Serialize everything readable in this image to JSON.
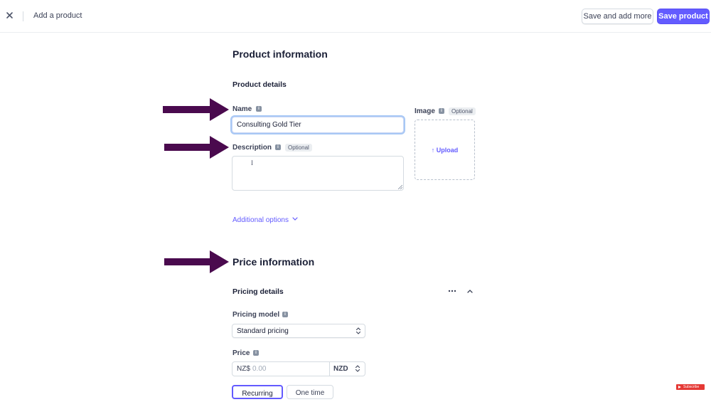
{
  "header": {
    "close_label": "×",
    "title": "Add a product",
    "save_and_add_more": "Save and add more",
    "save_product": "Save product"
  },
  "product_info": {
    "heading": "Product information",
    "details_heading": "Product details",
    "name_label": "Name",
    "name_value": "Consulting Gold Tier",
    "description_label": "Description",
    "description_badge": "Optional",
    "image_label": "Image",
    "image_badge": "Optional",
    "upload_label": "Upload",
    "additional_options": "Additional options"
  },
  "price_info": {
    "heading": "Price information",
    "pricing_details": "Pricing details",
    "pricing_model_label": "Pricing model",
    "pricing_model_value": "Standard pricing",
    "price_label": "Price",
    "price_prefix": "NZ$",
    "price_placeholder": "0.00",
    "currency": "NZD",
    "billing_options": [
      "Recurring",
      "One time"
    ],
    "billing_selected": "Recurring"
  },
  "overlay": {
    "subscribe_label": "Subscribe"
  },
  "colors": {
    "accent": "#635bff",
    "arrow": "#4a0a4e"
  },
  "icons": {
    "info": "info-icon",
    "close": "close-icon",
    "upload": "arrow-up-icon",
    "chevron": "chevron-down-icon"
  }
}
